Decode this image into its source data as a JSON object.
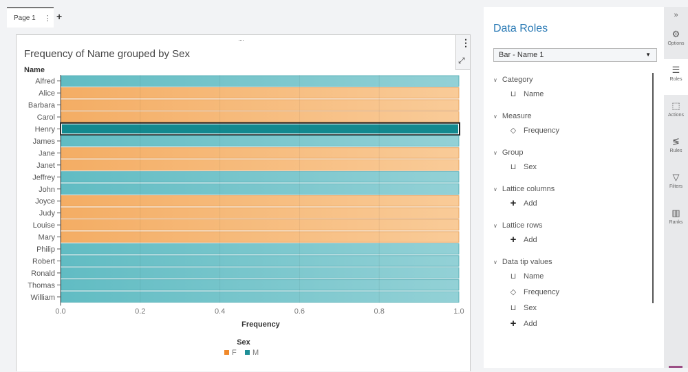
{
  "tabs": {
    "page_label": "Page 1",
    "menu_icon": "⋮",
    "add_icon": "+"
  },
  "report_object": {
    "drag_handle": "····",
    "more_icon": "⋮",
    "maximize_icon": "⤢"
  },
  "chart_data": {
    "type": "bar",
    "orientation": "horizontal",
    "title": "Frequency of Name grouped by Sex",
    "ylabel": "Name",
    "xlabel": "Frequency",
    "xlim": [
      0.0,
      1.0
    ],
    "xticks": [
      "0.0",
      "0.2",
      "0.4",
      "0.6",
      "0.8",
      "1.0"
    ],
    "categories": [
      "Alfred",
      "Alice",
      "Barbara",
      "Carol",
      "Henry",
      "James",
      "Jane",
      "Janet",
      "Jeffrey",
      "John",
      "Joyce",
      "Judy",
      "Louise",
      "Mary",
      "Philip",
      "Robert",
      "Ronald",
      "Thomas",
      "William"
    ],
    "groups": [
      "M",
      "F",
      "F",
      "F",
      "M",
      "M",
      "F",
      "F",
      "M",
      "M",
      "F",
      "F",
      "F",
      "F",
      "M",
      "M",
      "M",
      "M",
      "M"
    ],
    "values": [
      1,
      1,
      1,
      1,
      1,
      1,
      1,
      1,
      1,
      1,
      1,
      1,
      1,
      1,
      1,
      1,
      1,
      1,
      1
    ],
    "selected": "Henry",
    "grid": true,
    "legend": {
      "title": "Sex",
      "position": "bottom",
      "entries": [
        {
          "label": "F",
          "color": "#f0892b"
        },
        {
          "label": "M",
          "color": "#1f8f97"
        }
      ]
    },
    "colors": {
      "F": "#f4ad64",
      "M": "#61bcc3",
      "F_light": "#f9cb98",
      "M_light": "#93d1d6",
      "M_selected": "#13898f"
    }
  },
  "panel": {
    "title": "Data Roles",
    "object_select": "Bar - Name 1",
    "sections": [
      {
        "label": "Category",
        "items": [
          {
            "icon": "category-icon",
            "label": "Name"
          }
        ]
      },
      {
        "label": "Measure",
        "items": [
          {
            "icon": "measure-icon",
            "label": "Frequency"
          }
        ]
      },
      {
        "label": "Group",
        "items": [
          {
            "icon": "category-icon",
            "label": "Sex"
          }
        ]
      },
      {
        "label": "Lattice columns",
        "items": [
          {
            "icon": "add-icon",
            "label": "Add"
          }
        ]
      },
      {
        "label": "Lattice rows",
        "items": [
          {
            "icon": "add-icon",
            "label": "Add"
          }
        ]
      },
      {
        "label": "Data tip values",
        "items": [
          {
            "icon": "category-icon",
            "label": "Name"
          },
          {
            "icon": "measure-icon",
            "label": "Frequency"
          },
          {
            "icon": "category-icon",
            "label": "Sex"
          },
          {
            "icon": "add-icon",
            "label": "Add"
          }
        ]
      }
    ]
  },
  "rail": {
    "collapse": "»",
    "items": [
      {
        "label": "Options",
        "icon": "options-icon",
        "glyph": "⚙"
      },
      {
        "label": "Roles",
        "icon": "roles-icon",
        "glyph": "☰",
        "active": true
      },
      {
        "label": "Actions",
        "icon": "actions-icon",
        "glyph": "⬚"
      },
      {
        "label": "Rules",
        "icon": "rules-icon",
        "glyph": "≶"
      },
      {
        "label": "Filters",
        "icon": "filters-icon",
        "glyph": "▽"
      },
      {
        "label": "Ranks",
        "icon": "ranks-icon",
        "glyph": "▥"
      }
    ]
  }
}
